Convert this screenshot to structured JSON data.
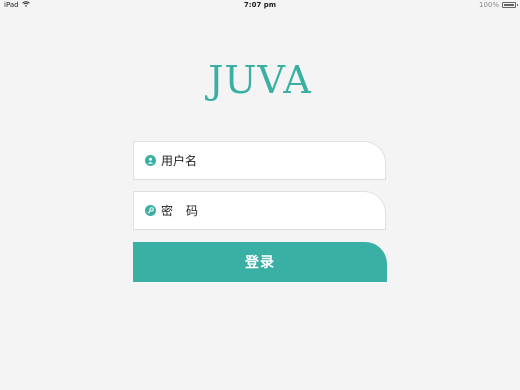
{
  "status_bar": {
    "device": "iPad",
    "wifi_icon": "wifi-icon",
    "time": "7:07 pm",
    "battery_text": "100%",
    "battery_level": 1.0
  },
  "app": {
    "logo": "JUVA",
    "accent_color": "#3aafa4"
  },
  "login_form": {
    "username": {
      "icon": "user-icon",
      "label": "用户名",
      "value": ""
    },
    "password": {
      "icon": "key-icon",
      "label": "密码",
      "value": ""
    },
    "submit_label": "登录"
  }
}
